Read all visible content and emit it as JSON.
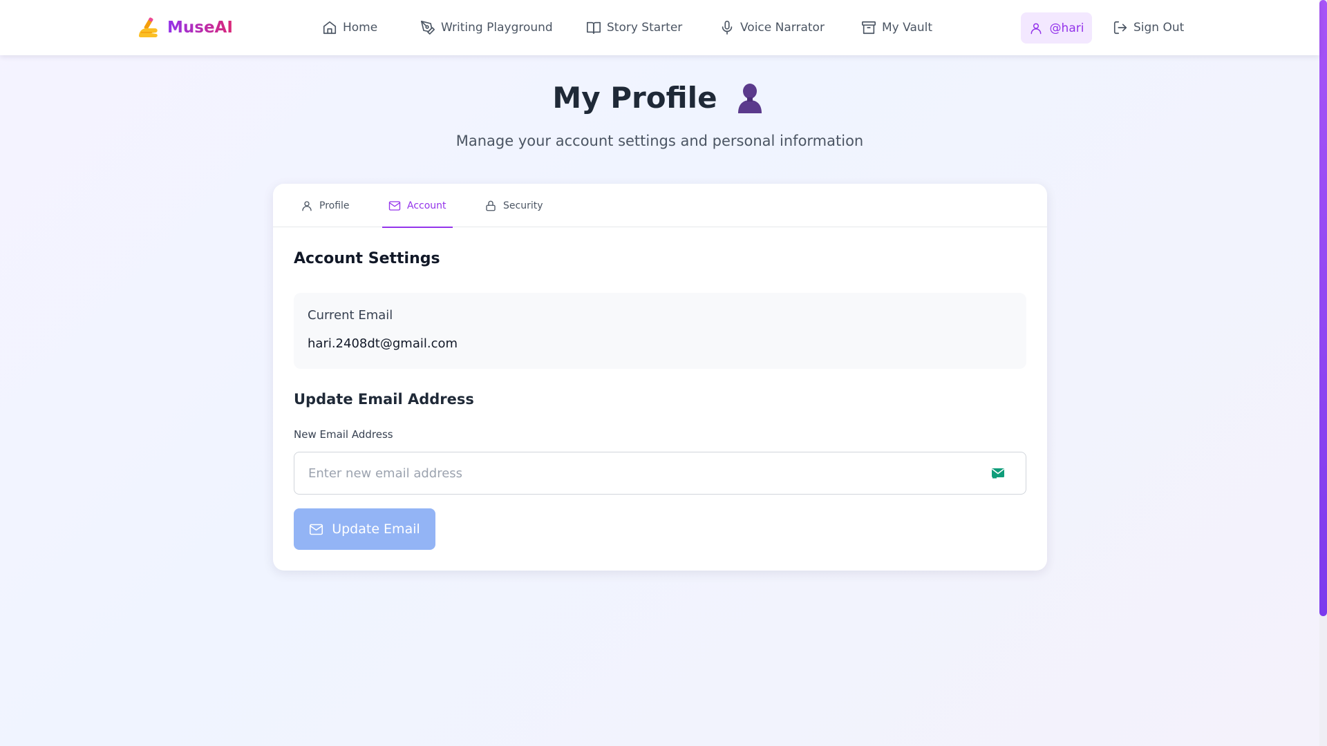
{
  "brand": {
    "name": "MuseAI",
    "logo_icon": "writing-hand-icon"
  },
  "nav": {
    "items": [
      {
        "label": "Home",
        "icon": "home-icon"
      },
      {
        "label": "Writing Playground",
        "icon": "pen-tool-icon"
      },
      {
        "label": "Story Starter",
        "icon": "book-open-icon"
      },
      {
        "label": "Voice Narrator",
        "icon": "microphone-icon"
      },
      {
        "label": "My Vault",
        "icon": "archive-icon"
      }
    ],
    "user": {
      "label": "@hari",
      "icon": "user-icon"
    },
    "signout": {
      "label": "Sign Out",
      "icon": "log-out-icon"
    }
  },
  "header": {
    "title": "My Profile",
    "title_icon": "bust-silhouette-icon",
    "subtitle": "Manage your account settings and personal information"
  },
  "tabs": [
    {
      "label": "Profile",
      "icon": "user-icon",
      "active": false
    },
    {
      "label": "Account",
      "icon": "mail-icon",
      "active": true
    },
    {
      "label": "Security",
      "icon": "lock-icon",
      "active": false
    }
  ],
  "account": {
    "section_title": "Account Settings",
    "current_email_label": "Current Email",
    "current_email_value": "hari.2408dt@gmail.com",
    "update_title": "Update Email Address",
    "new_email_label": "New Email Address",
    "new_email_placeholder": "Enter new email address",
    "new_email_value": "",
    "update_button_label": "Update Email"
  },
  "colors": {
    "accent": "#9333ea",
    "brand_gradient_end": "#db2777",
    "button_disabled": "#93b4f5",
    "user_chip_bg": "#f3e8ff"
  }
}
